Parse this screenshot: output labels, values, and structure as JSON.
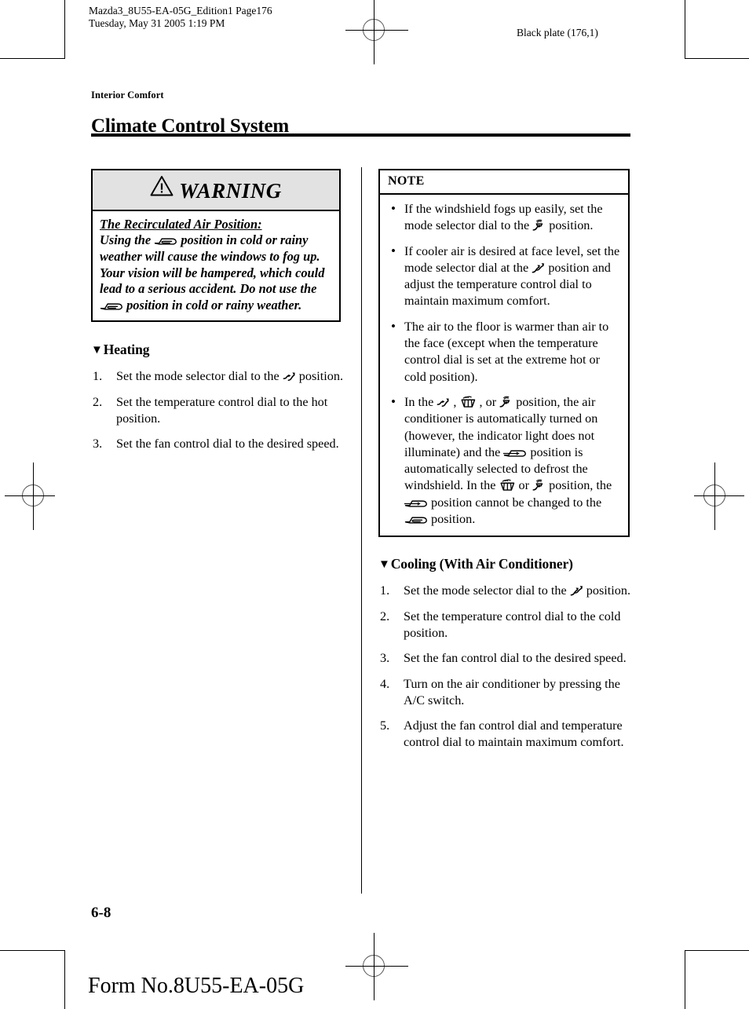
{
  "print_slug": {
    "job_line": "Mazda3_8U55-EA-05G_Edition1 Page176",
    "date_line": "Tuesday, May 31 2005 1:19 PM",
    "plate": "Black plate (176,1)"
  },
  "header": {
    "chapter_tag": "Interior Comfort",
    "title": "Climate Control System"
  },
  "warning": {
    "heading": "WARNING",
    "icon": "warning-triangle-icon",
    "subheading": "The Recirculated Air Position:",
    "body_part1": "Using the ",
    "body_part2": " position in cold or rainy weather will cause the windows to fog up. Your vision will be hampered, which could lead to a serious accident. Do not use the ",
    "body_part3": " position in cold or rainy weather."
  },
  "heating": {
    "heading": "Heating",
    "marker": "▼",
    "steps": [
      {
        "num": "1.",
        "text_before": "Set the mode selector dial to the ",
        "icon": "airflow-face-floor-icon",
        "text_after": " position."
      },
      {
        "num": "2.",
        "text_before": "Set the temperature control dial to the hot position.",
        "icon": "",
        "text_after": ""
      },
      {
        "num": "3.",
        "text_before": "Set the fan control dial to the desired speed.",
        "icon": "",
        "text_after": ""
      }
    ]
  },
  "note": {
    "heading": "NOTE",
    "bullet": "•",
    "items": [
      {
        "segments": [
          {
            "type": "text",
            "value": "If the windshield fogs up easily, set the mode selector dial to the "
          },
          {
            "type": "icon",
            "value": "airflow-defrost-floor-icon"
          },
          {
            "type": "text",
            "value": " position."
          }
        ]
      },
      {
        "segments": [
          {
            "type": "text",
            "value": "If cooler air is desired at face level, set the mode selector dial at the "
          },
          {
            "type": "icon",
            "value": "airflow-face-icon"
          },
          {
            "type": "text",
            "value": " position and adjust the temperature control dial to maintain maximum comfort."
          }
        ]
      },
      {
        "segments": [
          {
            "type": "text",
            "value": "The air to the floor is warmer than air to the face (except when the temperature control dial is set at the extreme hot or cold position)."
          }
        ]
      },
      {
        "segments": [
          {
            "type": "text",
            "value": "In the "
          },
          {
            "type": "icon",
            "value": "airflow-face-floor-icon"
          },
          {
            "type": "text",
            "value": " , "
          },
          {
            "type": "icon",
            "value": "airflow-defrost-icon"
          },
          {
            "type": "text",
            "value": " , or "
          },
          {
            "type": "icon",
            "value": "airflow-defrost-floor-icon"
          },
          {
            "type": "text",
            "value": " position, the air conditioner is automatically turned on (however, the indicator light does not illuminate) and the "
          },
          {
            "type": "icon",
            "value": "fresh-air-icon"
          },
          {
            "type": "text",
            "value": " position is automatically selected to defrost the windshield. In the "
          },
          {
            "type": "icon",
            "value": "airflow-defrost-icon"
          },
          {
            "type": "text",
            "value": " or "
          },
          {
            "type": "icon",
            "value": "airflow-defrost-floor-icon"
          },
          {
            "type": "text",
            "value": " position, the "
          },
          {
            "type": "icon",
            "value": "fresh-air-icon"
          },
          {
            "type": "text",
            "value": " position cannot be changed to the "
          },
          {
            "type": "icon",
            "value": "recirculated-air-icon"
          },
          {
            "type": "text",
            "value": " position."
          }
        ]
      }
    ]
  },
  "cooling": {
    "heading": "Cooling (With Air Conditioner)",
    "marker": "▼",
    "steps": [
      {
        "num": "1.",
        "text_before": "Set the mode selector dial to the ",
        "icon": "airflow-face-icon",
        "text_after": " position."
      },
      {
        "num": "2.",
        "text_before": "Set the temperature control dial to the cold position.",
        "icon": "",
        "text_after": ""
      },
      {
        "num": "3.",
        "text_before": "Set the fan control dial to the desired speed.",
        "icon": "",
        "text_after": ""
      },
      {
        "num": "4.",
        "text_before": "Turn on the air conditioner by pressing the A/C switch.",
        "icon": "",
        "text_after": ""
      },
      {
        "num": "5.",
        "text_before": "Adjust the fan control dial and temperature control dial to maintain maximum comfort.",
        "icon": "",
        "text_after": ""
      }
    ]
  },
  "footer": {
    "folio": "6-8",
    "form_no": "Form No.8U55-EA-05G"
  },
  "colors": {
    "ink": "#000000",
    "paper": "#ffffff",
    "warning_header_fill": "#e2e2e2"
  }
}
